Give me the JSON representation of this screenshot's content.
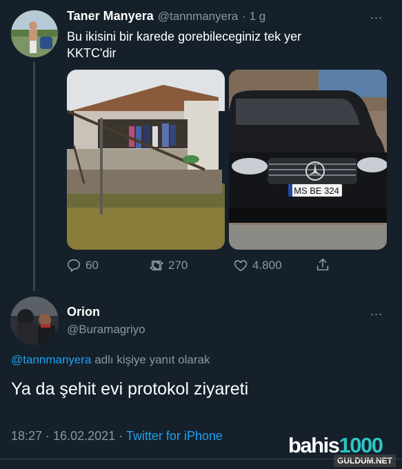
{
  "tweet": {
    "author_name": "Taner Manyera",
    "author_handle": "@tannmanyera",
    "time": "· 1 g",
    "text_line1": "Bu ikisini bir karede gorebileceginiz tek yer",
    "text_line2": "KKTC'dir",
    "license_plate": "MS BE 324",
    "actions": {
      "reply_count": "60",
      "retweet_count": "270",
      "like_count": "4.800"
    },
    "more_label": "..."
  },
  "reply": {
    "author_name": "Orion",
    "author_handle": "@Buramagriyo",
    "more_label": "...",
    "reply_to_handle": "@tannmanyera",
    "reply_to_suffix": " adlı kişiye yanıt olarak",
    "text": "Ya da şehit evi protokol ziyareti",
    "time": "18:27 · 16.02.2021 · ",
    "source": "Twitter for iPhone"
  },
  "watermark": {
    "logo_part1": "bahis",
    "logo_part2": "1000",
    "site": "GULDUM.NET"
  },
  "colors": {
    "background": "#15202b",
    "muted": "#8899a6",
    "accent": "#1da1f2"
  },
  "icons": [
    "reply-icon",
    "retweet-icon",
    "like-icon",
    "share-icon",
    "more-icon"
  ]
}
